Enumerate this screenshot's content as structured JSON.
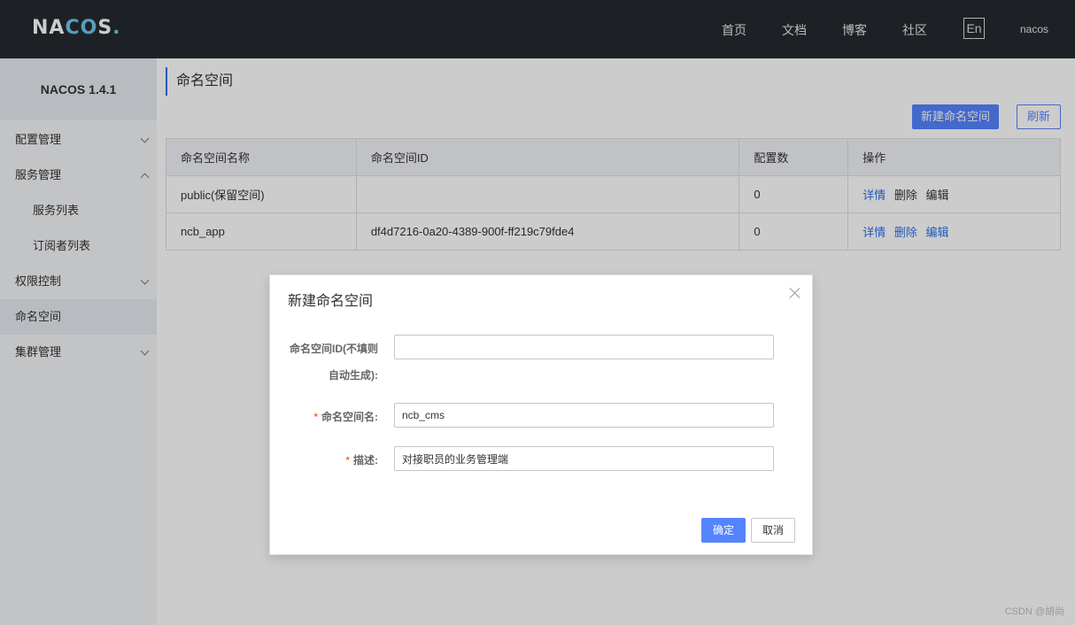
{
  "header": {
    "logo_pre": "NA",
    "logo_mid": "CO",
    "logo_post": "S",
    "logo_dot": ".",
    "nav": [
      "首页",
      "文档",
      "博客",
      "社区"
    ],
    "lang": "En",
    "user": "nacos"
  },
  "sidebar": {
    "title": "NACOS 1.4.1",
    "items": [
      {
        "label": "配置管理"
      },
      {
        "label": "服务管理"
      },
      {
        "label": "服务列表"
      },
      {
        "label": "订阅者列表"
      },
      {
        "label": "权限控制"
      },
      {
        "label": "命名空间"
      },
      {
        "label": "集群管理"
      }
    ]
  },
  "main": {
    "title": "命名空间",
    "new_button": "新建命名空间",
    "refresh_button": "刷新",
    "table": {
      "headers": [
        "命名空间名称",
        "命名空间ID",
        "配置数",
        "操作"
      ],
      "rows": [
        {
          "name": "public(保留空间)",
          "id": "",
          "count": "0",
          "ops": [
            "详情",
            "删除",
            "编辑"
          ]
        },
        {
          "name": "ncb_app",
          "id": "df4d7216-0a20-4389-900f-ff219c79fde4",
          "count": "0",
          "ops": [
            "详情",
            "删除",
            "编辑"
          ]
        }
      ]
    }
  },
  "dialog": {
    "title": "新建命名空间",
    "id_label_line1": "命名空间ID(不填则",
    "id_label_line2": "自动生成):",
    "id_value": "",
    "name_label": "命名空间名:",
    "name_value": "ncb_cms",
    "desc_label": "描述:",
    "desc_value": "对接职员的业务管理端",
    "required_mark": "*",
    "ok_button": "确定",
    "cancel_button": "取消"
  },
  "watermark": "CSDN @胡尚",
  "colors": {
    "header_bg": "#252a2f",
    "primary": "#5584ff",
    "link": "#2b6ff0",
    "required": "#ff3000"
  }
}
